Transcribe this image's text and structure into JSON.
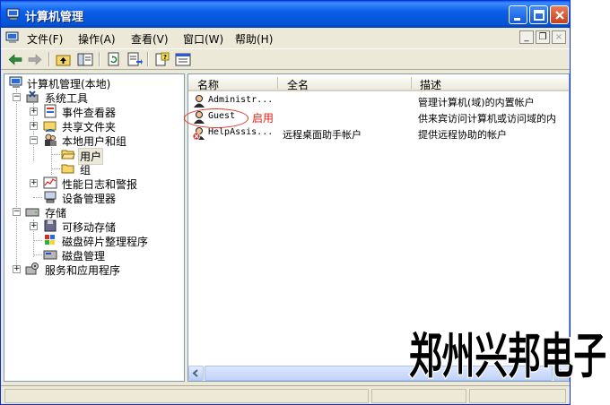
{
  "window": {
    "title": "计算机管理"
  },
  "menu": [
    {
      "label": "文件(F)"
    },
    {
      "label": "操作(A)"
    },
    {
      "label": "查看(V)"
    },
    {
      "label": "窗口(W)"
    },
    {
      "label": "帮助(H)"
    }
  ],
  "mdi_buttons": {
    "minimize": "_",
    "restore": "❐",
    "close": "×"
  },
  "tree": {
    "root": "计算机管理(本地)",
    "items": [
      {
        "label": "系统工具",
        "icon": "tools-icon"
      },
      {
        "label": "事件查看器",
        "icon": "event-viewer-icon"
      },
      {
        "label": "共享文件夹",
        "icon": "shared-folder-icon"
      },
      {
        "label": "本地用户和组",
        "icon": "users-groups-icon"
      },
      {
        "label": "用户",
        "icon": "folder-open-icon"
      },
      {
        "label": "组",
        "icon": "folder-icon"
      },
      {
        "label": "性能日志和警报",
        "icon": "performance-icon"
      },
      {
        "label": "设备管理器",
        "icon": "device-manager-icon"
      },
      {
        "label": "存储",
        "icon": "storage-icon"
      },
      {
        "label": "可移动存储",
        "icon": "removable-storage-icon"
      },
      {
        "label": "磁盘碎片整理程序",
        "icon": "defrag-icon"
      },
      {
        "label": "磁盘管理",
        "icon": "disk-management-icon"
      },
      {
        "label": "服务和应用程序",
        "icon": "services-icon"
      }
    ]
  },
  "list": {
    "columns": [
      "名称",
      "全名",
      "描述"
    ],
    "rows": [
      {
        "name": "Administr...",
        "full": "",
        "desc": "管理计算机(域)的内置帐户",
        "disabled": false
      },
      {
        "name": "Guest",
        "full": "",
        "desc": "供来宾访问计算机或访问域的内",
        "disabled": false
      },
      {
        "name": "HelpAssis...",
        "full": "远程桌面助手帐户",
        "desc": "提供远程协助的帐户",
        "disabled": true
      }
    ]
  },
  "annotation": {
    "note": "启用"
  },
  "watermark": {
    "text": "郑州兴邦电子"
  }
}
